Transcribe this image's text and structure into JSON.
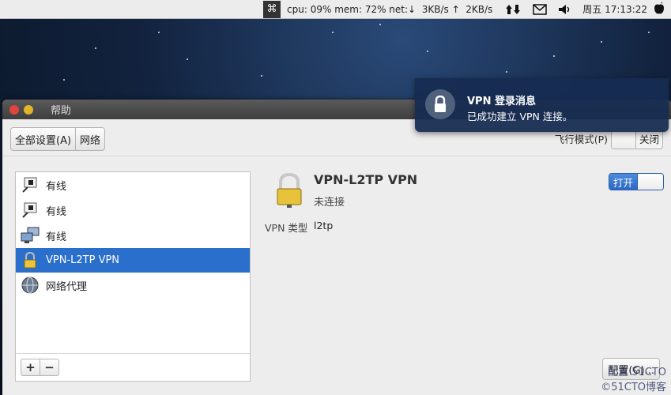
{
  "panel": {
    "stats": "cpu: 09% mem: 72% net:↓  3KB/s ↑  2KB/s",
    "cmd_symbol": "⌘",
    "clock": "周五 17:13:22"
  },
  "notification": {
    "title": "VPN 登录消息",
    "body": "已成功建立 VPN 连接。"
  },
  "window": {
    "title": "帮助",
    "toolbar": {
      "all_settings_label": "全部设置(A)",
      "network_label": "网络",
      "airplane_mode_label": "飞行模式(P)",
      "airplane_switch_label": "关闭"
    },
    "sidebar": {
      "items": [
        {
          "label": "有线",
          "icon": "wired-icon"
        },
        {
          "label": "有线",
          "icon": "wired-icon"
        },
        {
          "label": "有线",
          "icon": "network-computers-icon"
        },
        {
          "label": "VPN-L2TP VPN",
          "icon": "vpn-lock-icon",
          "selected": true
        },
        {
          "label": "网络代理",
          "icon": "globe-icon"
        }
      ],
      "add_label": "+",
      "remove_label": "−"
    },
    "detail": {
      "title": "VPN-L2TP VPN",
      "status": "未连接",
      "switch_label": "打开",
      "vpn_type_key": "VPN 类型",
      "vpn_type_value": "l2tp"
    },
    "config_button_label": "配置(G)..."
  },
  "watermark": {
    "line1": "配置·51CTO",
    "line2": "©51CTO博客"
  },
  "colors": {
    "selection": "#2a6fcb",
    "switch_on": "#3a7ad6",
    "notification_bg": "#162c52"
  }
}
